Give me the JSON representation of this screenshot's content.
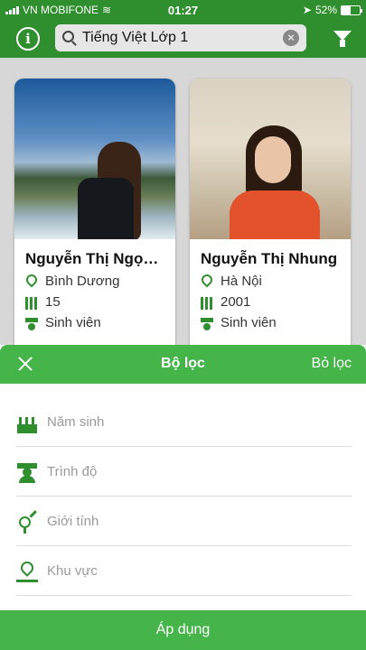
{
  "status_bar": {
    "carrier": "VN MOBIFONE",
    "time": "01:27",
    "battery_percent": "52%",
    "battery_level": 0.52
  },
  "header": {
    "search_value": "Tiếng Việt Lớp 1",
    "icons": [
      "info-icon",
      "search-icon",
      "clear-icon",
      "filter-icon"
    ]
  },
  "cards": [
    {
      "name": "Nguyễn Thị Ngọc…",
      "location": "Bình Dương",
      "birth": "15",
      "education": "Sinh viên"
    },
    {
      "name": "Nguyễn Thị Nhung",
      "location": "Hà Nội",
      "birth": "2001",
      "education": "Sinh viên"
    }
  ],
  "filter_sheet": {
    "title": "Bộ lọc",
    "clear_label": "Bỏ lọc",
    "rows": [
      {
        "label": "Năm sinh",
        "icon": "cake-icon"
      },
      {
        "label": "Trình độ",
        "icon": "graduate-icon"
      },
      {
        "label": "Giới tính",
        "icon": "gender-icon"
      },
      {
        "label": "Khu vực",
        "icon": "location-pin-icon"
      }
    ],
    "apply_label": "Áp dụng"
  },
  "colors": {
    "primary": "#45b54a",
    "primary_dark": "#2f8f2f",
    "overlay": "#d7d7d7"
  }
}
